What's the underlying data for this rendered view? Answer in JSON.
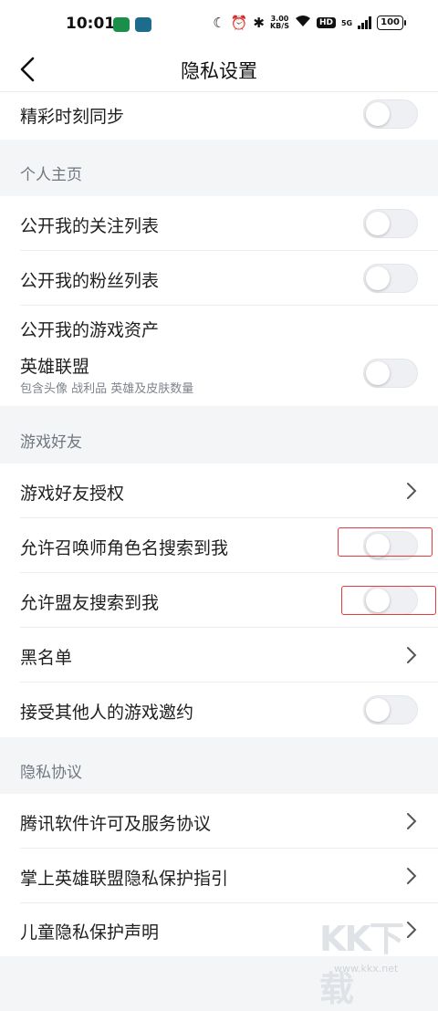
{
  "status_bar": {
    "time": "10:01",
    "speed": "3.00",
    "speed_unit": "KB/S",
    "hd": "HD",
    "network": "5G",
    "battery": "100"
  },
  "nav": {
    "title": "隐私设置"
  },
  "rows": {
    "highlight_sync": "精彩时刻同步",
    "show_following": "公开我的关注列表",
    "show_fans": "公开我的粉丝列表",
    "show_assets": "公开我的游戏资产",
    "lol": "英雄联盟",
    "lol_sub": "包含头像 战利品 英雄及皮肤数量",
    "friend_auth": "游戏好友授权",
    "search_by_summoner": "允许召唤师角色名搜索到我",
    "search_by_ally": "允许盟友搜索到我",
    "blacklist": "黑名单",
    "accept_invites": "接受其他人的游戏邀约",
    "tencent_license": "腾讯软件许可及服务协议",
    "privacy_guide": "掌上英雄联盟隐私保护指引",
    "child_privacy": "儿童隐私保护声明"
  },
  "sections": {
    "profile": "个人主页",
    "game_friends": "游戏好友",
    "privacy_agreement": "隐私协议"
  },
  "toggles": {
    "highlight_sync": false,
    "show_following": false,
    "show_fans": false,
    "lol_assets": false,
    "search_by_summoner": false,
    "search_by_ally": false,
    "accept_invites": false
  },
  "watermark": {
    "logo": "KK下载",
    "url": "www.kkx.net"
  },
  "colors": {
    "highlight_box": "#e23c3c",
    "toggle_off": "#eef0f4",
    "section_text": "#6f7780"
  }
}
